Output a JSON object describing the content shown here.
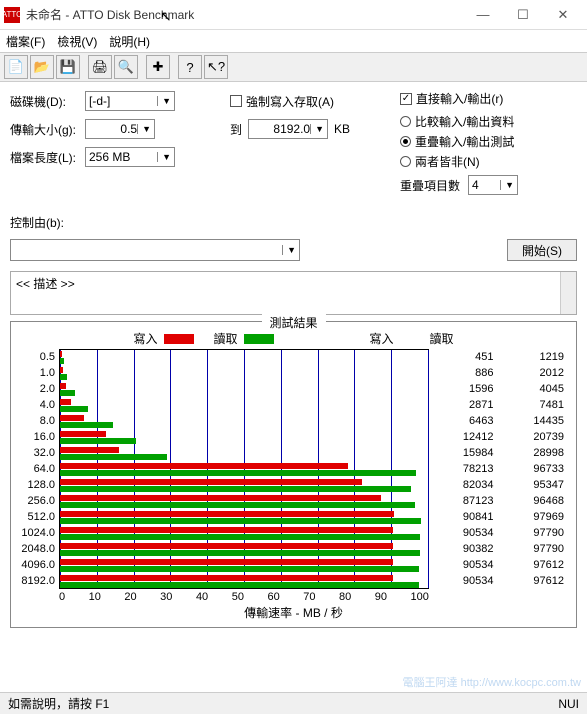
{
  "window": {
    "icon_text": "ATTO",
    "title": "未命名 - ATTO Disk Benchmark",
    "min": "—",
    "max": "☐",
    "close": "✕"
  },
  "menu": {
    "file": "檔案(F)",
    "view": "檢視(V)",
    "help": "說明(H)"
  },
  "toolbar_icons": [
    "new",
    "open",
    "save",
    "print",
    "zoom",
    "add",
    "help",
    "whatsthis"
  ],
  "settings": {
    "drive_label": "磁碟機(D):",
    "drive_value": "[-d-]",
    "xfer_label": "傳輸大小(g):",
    "xfer_from": "0.5",
    "to_label": "到",
    "xfer_to": "8192.0",
    "kb": "KB",
    "filelen_label": "檔案長度(L):",
    "filelen_value": "256 MB",
    "force_write": "強制寫入存取(A)",
    "direct_io": "直接輸入/輸出(r)",
    "radio_compare": "比較輸入/輸出資料",
    "radio_overlap": "重疊輸入/輸出測試",
    "radio_neither": "兩者皆非(N)",
    "overlap_count_label": "重疊項目數",
    "overlap_count_value": "4"
  },
  "control": {
    "label": "控制由(b):",
    "value": "",
    "start": "開始(S)"
  },
  "description": "<< 描述 >>",
  "results": {
    "title": "測試結果",
    "legend_write": "寫入",
    "legend_read": "讀取",
    "col_write": "寫入",
    "col_read": "讀取",
    "xlabel": "傳輸速率 - MB / 秒",
    "xticks": [
      "0",
      "10",
      "20",
      "30",
      "40",
      "50",
      "60",
      "70",
      "80",
      "90",
      "100"
    ]
  },
  "chart_data": {
    "type": "bar",
    "orientation": "horizontal",
    "xlabel": "傳輸速率 - MB / 秒",
    "ylabel": "",
    "xlim": [
      0,
      100
    ],
    "unit_values": "KB/秒",
    "categories": [
      "0.5",
      "1.0",
      "2.0",
      "4.0",
      "8.0",
      "16.0",
      "32.0",
      "64.0",
      "128.0",
      "256.0",
      "512.0",
      "1024.0",
      "2048.0",
      "4096.0",
      "8192.0"
    ],
    "series": [
      {
        "name": "寫入",
        "color": "#e00000",
        "values": [
          451,
          886,
          1596,
          2871,
          6463,
          12412,
          15984,
          78213,
          82034,
          87123,
          90841,
          90534,
          90382,
          90534,
          90534
        ]
      },
      {
        "name": "讀取",
        "color": "#00a000",
        "values": [
          1219,
          2012,
          4045,
          7481,
          14435,
          20739,
          28998,
          96733,
          95347,
          96468,
          97969,
          97790,
          97790,
          97612,
          97612
        ]
      }
    ]
  },
  "status": {
    "left": "如需說明，請按 F1",
    "right": "NUI"
  },
  "watermark": "電腦王阿達  http://www.kocpc.com.tw"
}
